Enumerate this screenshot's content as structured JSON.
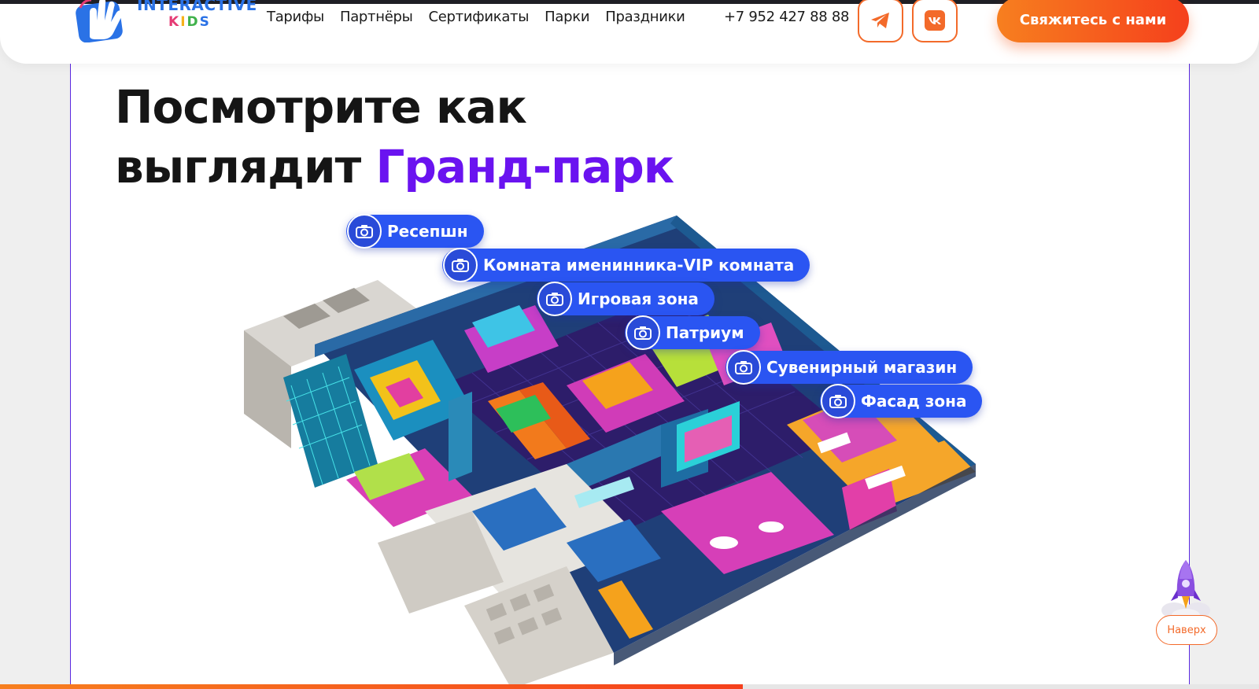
{
  "header": {
    "logo": {
      "top": "INTERACTIVE",
      "bottom": [
        "K",
        "I",
        "D",
        "S"
      ]
    },
    "nav": [
      "Тарифы",
      "Партнёры",
      "Сертификаты",
      "Парки",
      "Праздники"
    ],
    "phone": "+7 952 427 88 88",
    "social": [
      "telegram-icon",
      "vk-icon"
    ],
    "cta_label": "Свяжитесь с нами"
  },
  "section": {
    "title_line1": "Посмотрите как",
    "title_line2_prefix": "выглядит ",
    "title_line2_accent": "Гранд-парк"
  },
  "hotspots": [
    "Ресепшн",
    "Комната именинника-VIP комната",
    "Игровая зона",
    "Патриум",
    "Сувенирный магазин",
    "Фасад зона"
  ],
  "back_to_top": "Наверх",
  "scroll_progress": 0.59,
  "colors": {
    "accent_purple": "#6a13f0",
    "accent_orange": "#f5401c",
    "hotspot_blue": "#2a55f2"
  }
}
